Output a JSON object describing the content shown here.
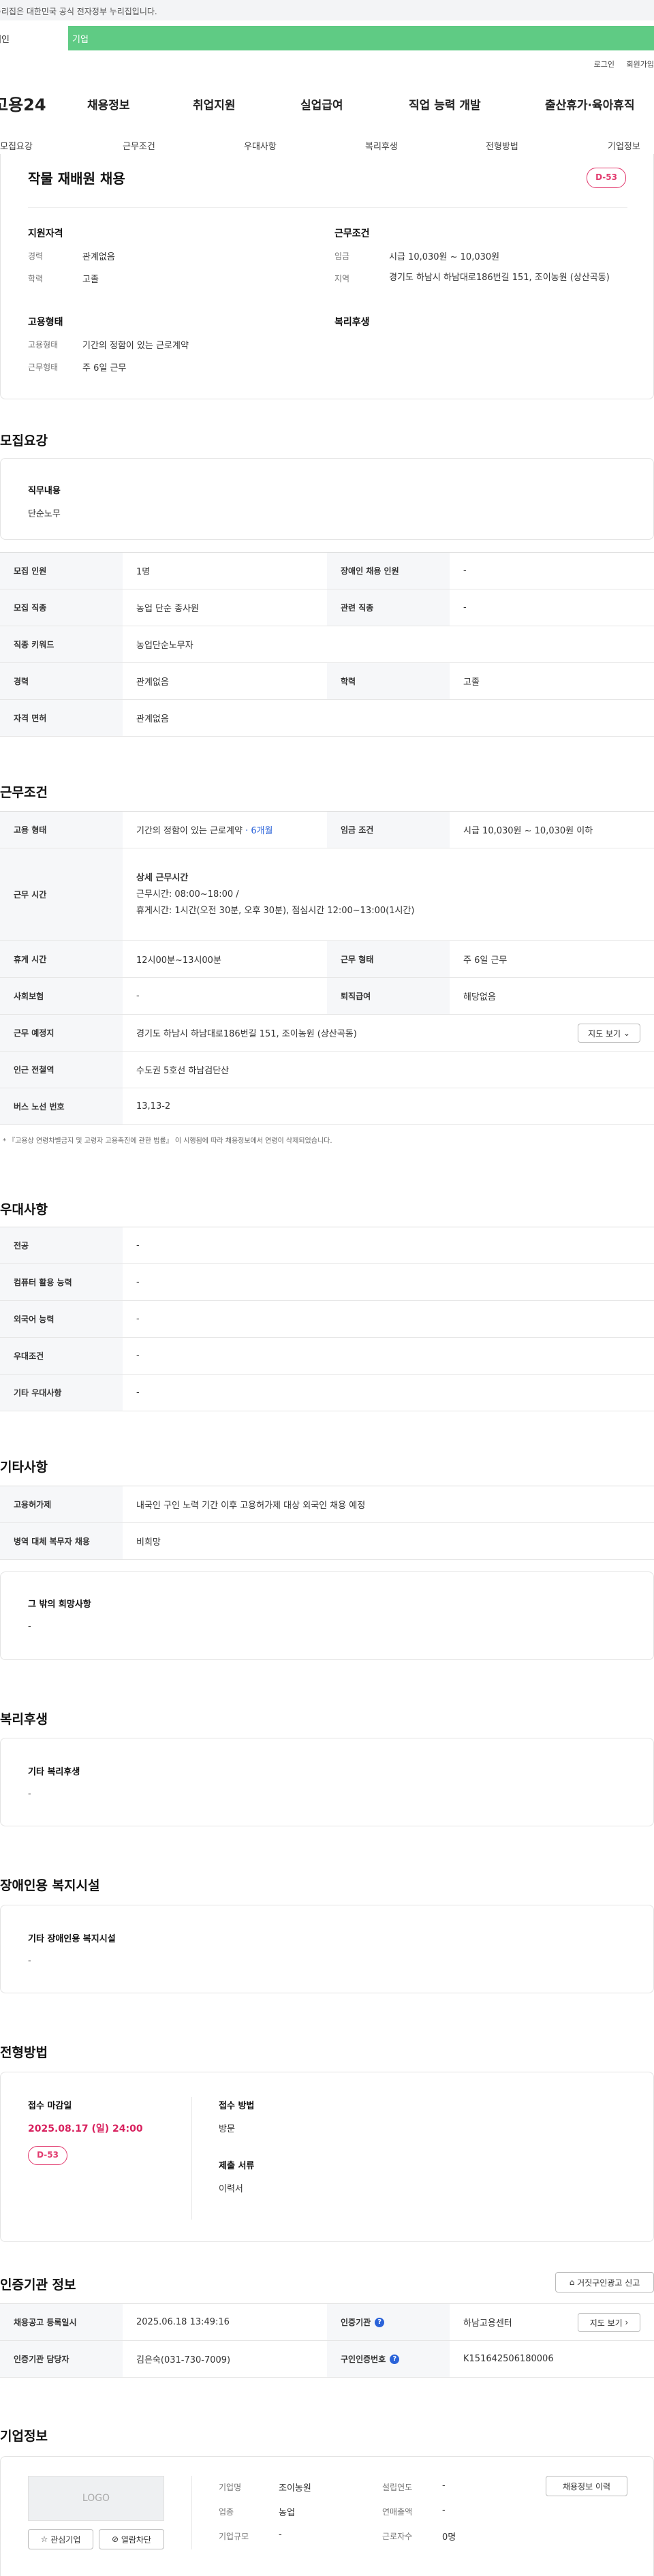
{
  "notice": "이 누리집은 대한민국 공식 전자정부 누리집입니다.",
  "tabs": {
    "individual": "개인",
    "company": "기업"
  },
  "util": {
    "login": "로그인",
    "signup": "회원가입"
  },
  "logo": "고용24",
  "mainnav": [
    "채용정보",
    "취업지원",
    "실업급여",
    "직업 능력 개발",
    "출산휴가·육아휴직"
  ],
  "subnav": [
    "모집요강",
    "근무조건",
    "우대사항",
    "복리후생",
    "전형방법",
    "기업정보"
  ],
  "summary": {
    "title": "작물 재배원 채용",
    "dday": "D-53",
    "qualification": {
      "heading": "지원자격",
      "career_label": "경력",
      "career_value": "관계없음",
      "edu_label": "학력",
      "edu_value": "고졸"
    },
    "conditions": {
      "heading": "근무조건",
      "wage_label": "임금",
      "wage_value": "시급 10,030원 ~ 10,030원",
      "region_label": "지역",
      "region_value": "경기도 하남시 하남대로186번길 151, 조이농원 (상산곡동)"
    },
    "employment": {
      "heading": "고용형태",
      "type_label": "고용형태",
      "type_value": "기간의 정함이 있는 근로계약",
      "worktype_label": "근무형태",
      "worktype_value": "주 6일 근무"
    },
    "welfare_heading": "복리후생"
  },
  "recruit": {
    "heading": "모집요강",
    "duty_label": "직무내용",
    "duty_value": "단순노무",
    "rows": [
      {
        "l1": "모집 인원",
        "v1": "1명",
        "l2": "장애인 채용 인원",
        "v2": "-"
      },
      {
        "l1": "모집 직종",
        "v1": "농업 단순 종사원",
        "l2": "관련 직종",
        "v2": "-"
      },
      {
        "l1": "직종 키워드",
        "v1": "농업단순노무자"
      },
      {
        "l1": "경력",
        "v1": "관계없음",
        "l2": "학력",
        "v2": "고졸"
      },
      {
        "l1": "자격 면허",
        "v1": "관계없음"
      }
    ]
  },
  "work": {
    "heading": "근무조건",
    "emp_label": "고용 형태",
    "emp_value": "기간의 정함이 있는 근로계약",
    "emp_period": "· 6개월",
    "wage_label": "임금 조건",
    "wage_value": "시급 10,030원 ~ 10,030원 이하",
    "hours_label": "근무 시간",
    "hours_title": "상세 근무시간",
    "hours_line1": "근무시간: 08:00~18:00 /",
    "hours_line2": "휴게시간: 1시간(오전 30분, 오후 30분), 점심시간 12:00~13:00(1시간)",
    "break_label": "휴게 시간",
    "break_value": "12시00분~13시00분",
    "form_label": "근무 형태",
    "form_value": "주 6일 근무",
    "insurance_label": "사회보험",
    "insurance_value": "-",
    "severance_label": "퇴직급여",
    "severance_value": "해당없음",
    "place_label": "근무 예정지",
    "place_value": "경기도 하남시 하남대로186번길 151, 조이농원 (상산곡동)",
    "map_button": "지도 보기",
    "subway_label": "인근 전철역",
    "subway_value": "수도권 5호선 하남검단산",
    "bus_label": "버스 노선 번호",
    "bus_value": "13,13-2",
    "footnote": "* 『고용상 연령차별금지 및 고령자 고용촉진에 관한 법률』 이 시행됨에 따라 채용정보에서 연령이 삭제되었습니다."
  },
  "pref": {
    "heading": "우대사항",
    "rows": [
      {
        "l": "전공",
        "v": "-"
      },
      {
        "l": "컴퓨터 활용 능력",
        "v": "-"
      },
      {
        "l": "외국어 능력",
        "v": "-"
      },
      {
        "l": "우대조건",
        "v": "-"
      },
      {
        "l": "기타 우대사항",
        "v": "-"
      }
    ]
  },
  "other": {
    "heading": "기타사항",
    "rows": [
      {
        "l": "고용허가제",
        "v": "내국인 구인 노력 기간 이후 고용허가제 대상 외국인 채용 예정"
      },
      {
        "l": "병역 대체 복무자 채용",
        "v": "비희망"
      }
    ],
    "wish_label": "그 밖의 희망사항",
    "wish_value": "-"
  },
  "welfare": {
    "heading": "복리후생",
    "label": "기타 복리후생",
    "value": "-"
  },
  "disability": {
    "heading": "장애인용 복지시설",
    "label": "기타 장애인용 복지시설",
    "value": "-"
  },
  "selection": {
    "heading": "전형방법",
    "deadline_label": "접수 마감일",
    "deadline_value": "2025.08.17 (일) 24:00",
    "dday": "D-53",
    "method_label": "접수 방법",
    "method_value": "방문",
    "docs_label": "제출 서류",
    "docs_value": "이력서"
  },
  "cert": {
    "heading": "인증기관 정보",
    "report_button": "거짓구인광고 신고",
    "reg_label": "채용공고 등록일시",
    "reg_value": "2025.06.18 13:49:16",
    "agency_label": "인증기관",
    "agency_value": "하남고용센터",
    "map_button": "지도 보기",
    "manager_label": "인증기관 담당자",
    "manager_value": "김은숙(031-730-7009)",
    "number_label": "구인인증번호",
    "number_value": "K151642506180006"
  },
  "company": {
    "heading": "기업정보",
    "logo_text": "LOGO",
    "fav_button": "관심기업",
    "block_button": "열람차단",
    "name_label": "기업명",
    "name_value": "조이농원",
    "industry_label": "업종",
    "industry_value": "농업",
    "size_label": "기업규모",
    "size_value": "-",
    "founded_label": "설립연도",
    "founded_value": "-",
    "sales_label": "연매출액",
    "sales_value": "-",
    "staff_label": "근로자수",
    "staff_value": "0명",
    "jobs_button": "채용정보 이력"
  },
  "colors": {
    "accent_green": "#5fcb84",
    "dday_pink": "#e23a6e",
    "link_blue": "#2b63d9"
  }
}
